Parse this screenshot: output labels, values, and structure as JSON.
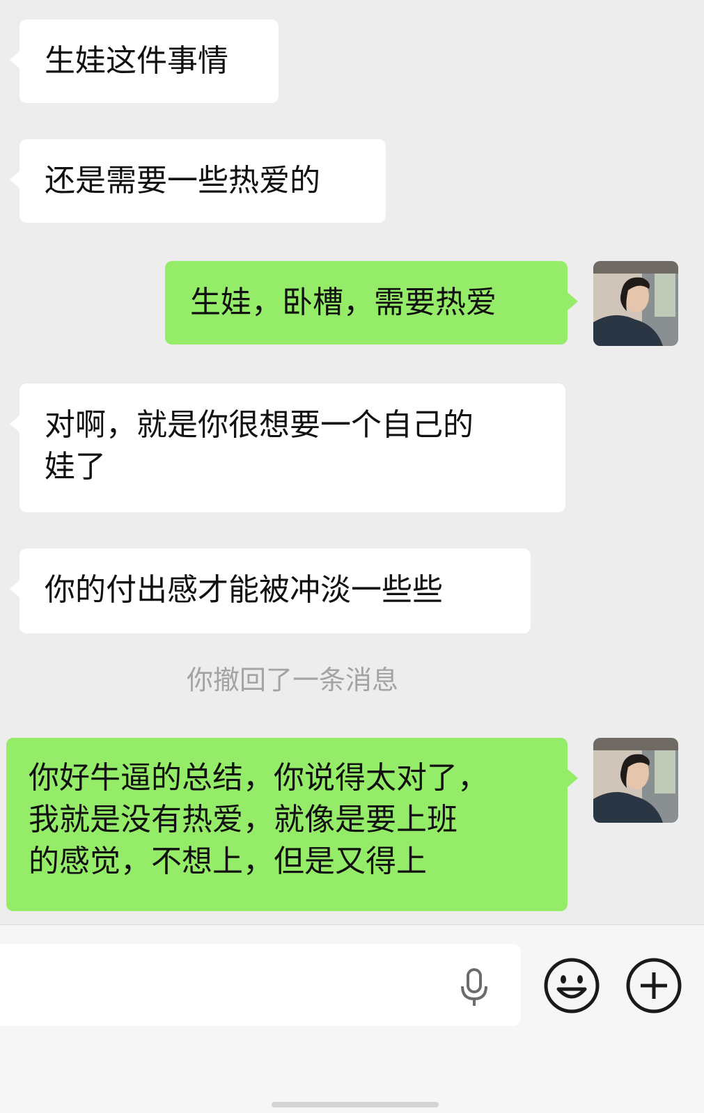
{
  "messages": [
    {
      "side": "incoming",
      "text": "生娃这件事情"
    },
    {
      "side": "incoming",
      "text": "还是需要一些热爱的"
    },
    {
      "side": "outgoing",
      "text": "生娃，卧槽，需要热爱"
    },
    {
      "side": "incoming",
      "text": "对啊，就是你很想要一个自己的\n娃了"
    },
    {
      "side": "incoming",
      "text": "你的付出感才能被冲淡一些些"
    },
    {
      "side": "system",
      "text": "你撤回了一条消息"
    },
    {
      "side": "outgoing",
      "text": "你好牛逼的总结，你说得太对了，\n我就是没有热爱，就像是要上班\n的感觉，不想上，但是又得上"
    }
  ],
  "input_bar": {
    "value": "",
    "icons": [
      "voice-icon",
      "emoji-icon",
      "plus-icon"
    ]
  },
  "colors": {
    "background": "#ededed",
    "incoming_bubble": "#ffffff",
    "outgoing_bubble": "#95ec69",
    "system_text": "#a3a3a3"
  }
}
